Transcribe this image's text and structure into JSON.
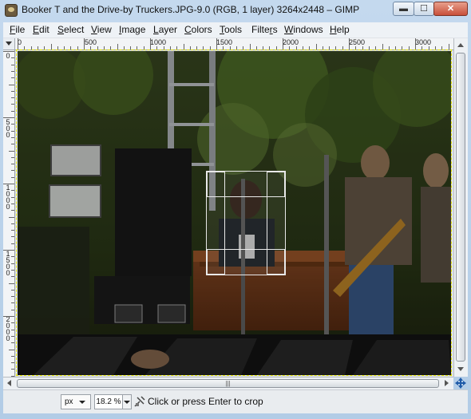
{
  "window": {
    "title": "Booker T and the Drive-by Truckers.JPG-9.0 (RGB, 1 layer) 3264x2448 – GIMP",
    "minimize_glyph": "▬",
    "maximize_glyph": "☐",
    "close_glyph": "✕"
  },
  "menubar": {
    "items": [
      {
        "label": "File",
        "mnemonic": "F",
        "rest": "ile"
      },
      {
        "label": "Edit",
        "mnemonic": "E",
        "rest": "dit"
      },
      {
        "label": "Select",
        "mnemonic": "S",
        "rest": "elect"
      },
      {
        "label": "View",
        "mnemonic": "V",
        "rest": "iew"
      },
      {
        "label": "Image",
        "mnemonic": "I",
        "rest": "mage"
      },
      {
        "label": "Layer",
        "mnemonic": "L",
        "rest": "ayer"
      },
      {
        "label": "Colors",
        "mnemonic": "C",
        "rest": "olors"
      },
      {
        "label": "Tools",
        "mnemonic": "T",
        "rest": "ools"
      },
      {
        "label": "Filters",
        "pre": "Filte",
        "mnemonic": "r",
        "rest": "s"
      },
      {
        "label": "Windows",
        "mnemonic": "W",
        "rest": "indows"
      },
      {
        "label": "Help",
        "mnemonic": "H",
        "rest": "elp"
      }
    ]
  },
  "rulers": {
    "horizontal_labels": [
      "0",
      "500",
      "1000",
      "1500",
      "2000",
      "2500",
      "3000"
    ],
    "vertical_labels": [
      "0",
      "500",
      "1000",
      "1500",
      "2000"
    ]
  },
  "image": {
    "description_icon": "photo-canvas",
    "boundary_color": "#e6e600"
  },
  "scrollbars": {
    "h_thumb_grip": "|||"
  },
  "statusbar": {
    "unit": "px",
    "zoom": "18.2 %",
    "message": "Click or press Enter to crop"
  },
  "colors": {
    "titlebar": "#b2cce6",
    "close_button": "#c8503a"
  }
}
